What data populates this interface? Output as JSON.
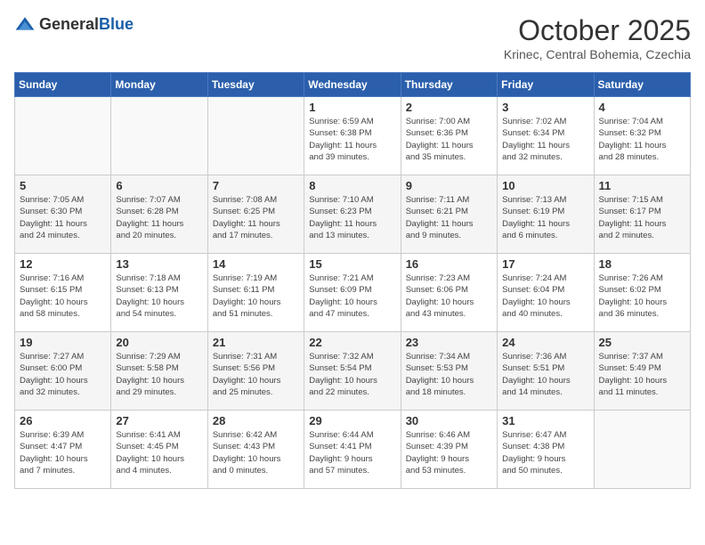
{
  "logo": {
    "general": "General",
    "blue": "Blue"
  },
  "header": {
    "month": "October 2025",
    "location": "Krinec, Central Bohemia, Czechia"
  },
  "weekdays": [
    "Sunday",
    "Monday",
    "Tuesday",
    "Wednesday",
    "Thursday",
    "Friday",
    "Saturday"
  ],
  "weeks": [
    [
      {
        "day": "",
        "info": ""
      },
      {
        "day": "",
        "info": ""
      },
      {
        "day": "",
        "info": ""
      },
      {
        "day": "1",
        "info": "Sunrise: 6:59 AM\nSunset: 6:38 PM\nDaylight: 11 hours\nand 39 minutes."
      },
      {
        "day": "2",
        "info": "Sunrise: 7:00 AM\nSunset: 6:36 PM\nDaylight: 11 hours\nand 35 minutes."
      },
      {
        "day": "3",
        "info": "Sunrise: 7:02 AM\nSunset: 6:34 PM\nDaylight: 11 hours\nand 32 minutes."
      },
      {
        "day": "4",
        "info": "Sunrise: 7:04 AM\nSunset: 6:32 PM\nDaylight: 11 hours\nand 28 minutes."
      }
    ],
    [
      {
        "day": "5",
        "info": "Sunrise: 7:05 AM\nSunset: 6:30 PM\nDaylight: 11 hours\nand 24 minutes."
      },
      {
        "day": "6",
        "info": "Sunrise: 7:07 AM\nSunset: 6:28 PM\nDaylight: 11 hours\nand 20 minutes."
      },
      {
        "day": "7",
        "info": "Sunrise: 7:08 AM\nSunset: 6:25 PM\nDaylight: 11 hours\nand 17 minutes."
      },
      {
        "day": "8",
        "info": "Sunrise: 7:10 AM\nSunset: 6:23 PM\nDaylight: 11 hours\nand 13 minutes."
      },
      {
        "day": "9",
        "info": "Sunrise: 7:11 AM\nSunset: 6:21 PM\nDaylight: 11 hours\nand 9 minutes."
      },
      {
        "day": "10",
        "info": "Sunrise: 7:13 AM\nSunset: 6:19 PM\nDaylight: 11 hours\nand 6 minutes."
      },
      {
        "day": "11",
        "info": "Sunrise: 7:15 AM\nSunset: 6:17 PM\nDaylight: 11 hours\nand 2 minutes."
      }
    ],
    [
      {
        "day": "12",
        "info": "Sunrise: 7:16 AM\nSunset: 6:15 PM\nDaylight: 10 hours\nand 58 minutes."
      },
      {
        "day": "13",
        "info": "Sunrise: 7:18 AM\nSunset: 6:13 PM\nDaylight: 10 hours\nand 54 minutes."
      },
      {
        "day": "14",
        "info": "Sunrise: 7:19 AM\nSunset: 6:11 PM\nDaylight: 10 hours\nand 51 minutes."
      },
      {
        "day": "15",
        "info": "Sunrise: 7:21 AM\nSunset: 6:09 PM\nDaylight: 10 hours\nand 47 minutes."
      },
      {
        "day": "16",
        "info": "Sunrise: 7:23 AM\nSunset: 6:06 PM\nDaylight: 10 hours\nand 43 minutes."
      },
      {
        "day": "17",
        "info": "Sunrise: 7:24 AM\nSunset: 6:04 PM\nDaylight: 10 hours\nand 40 minutes."
      },
      {
        "day": "18",
        "info": "Sunrise: 7:26 AM\nSunset: 6:02 PM\nDaylight: 10 hours\nand 36 minutes."
      }
    ],
    [
      {
        "day": "19",
        "info": "Sunrise: 7:27 AM\nSunset: 6:00 PM\nDaylight: 10 hours\nand 32 minutes."
      },
      {
        "day": "20",
        "info": "Sunrise: 7:29 AM\nSunset: 5:58 PM\nDaylight: 10 hours\nand 29 minutes."
      },
      {
        "day": "21",
        "info": "Sunrise: 7:31 AM\nSunset: 5:56 PM\nDaylight: 10 hours\nand 25 minutes."
      },
      {
        "day": "22",
        "info": "Sunrise: 7:32 AM\nSunset: 5:54 PM\nDaylight: 10 hours\nand 22 minutes."
      },
      {
        "day": "23",
        "info": "Sunrise: 7:34 AM\nSunset: 5:53 PM\nDaylight: 10 hours\nand 18 minutes."
      },
      {
        "day": "24",
        "info": "Sunrise: 7:36 AM\nSunset: 5:51 PM\nDaylight: 10 hours\nand 14 minutes."
      },
      {
        "day": "25",
        "info": "Sunrise: 7:37 AM\nSunset: 5:49 PM\nDaylight: 10 hours\nand 11 minutes."
      }
    ],
    [
      {
        "day": "26",
        "info": "Sunrise: 6:39 AM\nSunset: 4:47 PM\nDaylight: 10 hours\nand 7 minutes."
      },
      {
        "day": "27",
        "info": "Sunrise: 6:41 AM\nSunset: 4:45 PM\nDaylight: 10 hours\nand 4 minutes."
      },
      {
        "day": "28",
        "info": "Sunrise: 6:42 AM\nSunset: 4:43 PM\nDaylight: 10 hours\nand 0 minutes."
      },
      {
        "day": "29",
        "info": "Sunrise: 6:44 AM\nSunset: 4:41 PM\nDaylight: 9 hours\nand 57 minutes."
      },
      {
        "day": "30",
        "info": "Sunrise: 6:46 AM\nSunset: 4:39 PM\nDaylight: 9 hours\nand 53 minutes."
      },
      {
        "day": "31",
        "info": "Sunrise: 6:47 AM\nSunset: 4:38 PM\nDaylight: 9 hours\nand 50 minutes."
      },
      {
        "day": "",
        "info": ""
      }
    ]
  ]
}
